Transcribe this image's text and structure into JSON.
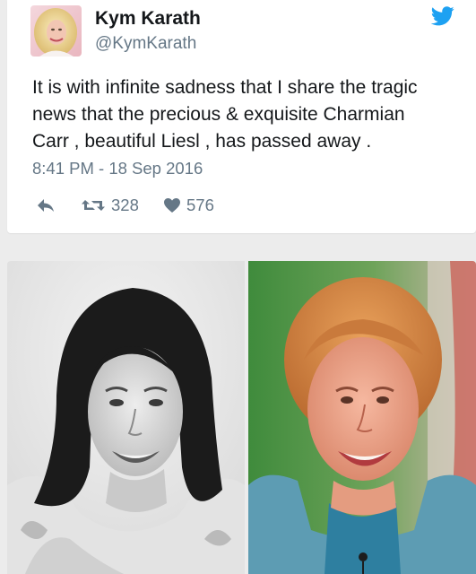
{
  "user": {
    "display_name": "Kym Karath",
    "handle": "@KymKarath"
  },
  "tweet": {
    "text_lines": [
      "It is with infinite sadness that I share the tragic",
      "news that the precious & exquisite Charmian",
      "Carr , beautiful Liesl , has passed away ."
    ],
    "timestamp": "8:41 PM - 18 Sep 2016"
  },
  "actions": {
    "reply_icon": "reply-icon",
    "retweet_icon": "retweet-icon",
    "retweet_count": "328",
    "like_icon": "heart-icon",
    "like_count": "576"
  },
  "icons": {
    "brand": "twitter-bird-icon"
  },
  "colors": {
    "twitter_blue": "#1da1f2",
    "secondary_text": "#657786",
    "primary_text": "#14171a"
  },
  "media": {
    "photos": [
      "black-and-white portrait photo",
      "color portrait photo"
    ]
  }
}
